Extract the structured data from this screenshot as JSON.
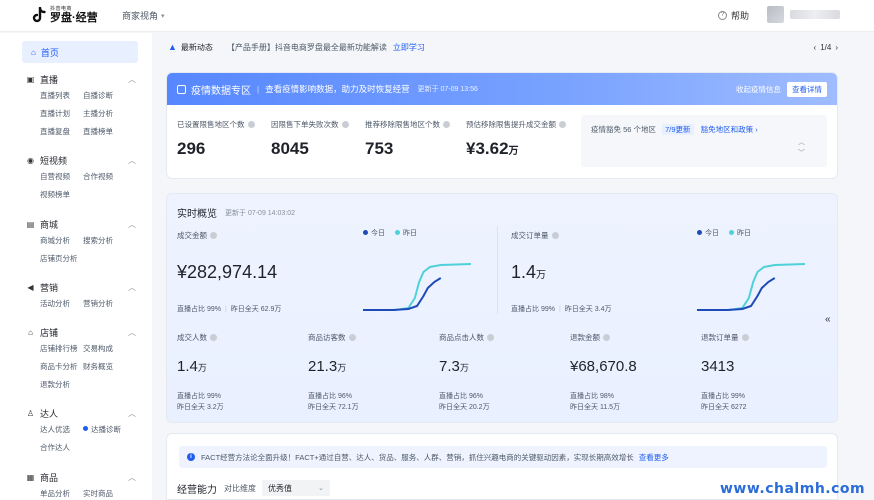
{
  "header": {
    "logo_sub": "抖音电商",
    "logo_main": "罗盘·经营",
    "role": "商家视角",
    "help": "帮助"
  },
  "sidebar": {
    "home": "首页",
    "groups": [
      {
        "title": "直播",
        "icon": "live-icon",
        "items": [
          "直播列表",
          "自播诊断",
          "直播计划",
          "主播分析",
          "直播复盘",
          "直播榜单"
        ]
      },
      {
        "title": "短视频",
        "icon": "video-icon",
        "items": [
          "自营视频",
          "合作视频",
          "视频榜单"
        ]
      },
      {
        "title": "商城",
        "icon": "mall-icon",
        "items": [
          "商城分析",
          "搜索分析",
          "店铺页分析"
        ]
      },
      {
        "title": "营销",
        "icon": "marketing-icon",
        "items": [
          "活动分析",
          "营销分析"
        ]
      },
      {
        "title": "店铺",
        "icon": "shop-icon",
        "items": [
          "店铺排行榜",
          "交易构成",
          "商品卡分析",
          "财务概览",
          "退款分析"
        ]
      },
      {
        "title": "达人",
        "icon": "talent-icon",
        "items": [
          "达人优选",
          "达播诊断",
          "合作达人"
        ]
      },
      {
        "title": "商品",
        "icon": "goods-icon",
        "items": [
          "单品分析",
          "实时商品"
        ]
      }
    ]
  },
  "news": {
    "title": "最新动态",
    "text": "【产品手册】抖音电商罗盘最全最新功能解读",
    "link": "立即学习",
    "page": "1/4"
  },
  "epidemic": {
    "title": "疫情数据专区",
    "subtitle": "查看疫情影响数据，助力及时恢复经营",
    "updated": "更新于 07-09 13:56",
    "collapse": "收起疫情信息",
    "detail_btn": "查看详情",
    "metrics": [
      {
        "label": "已设置限售地区个数",
        "value": "296",
        "unit": ""
      },
      {
        "label": "因限售下单失败次数",
        "value": "8045",
        "unit": ""
      },
      {
        "label": "推荐移除限售地区个数",
        "value": "753",
        "unit": ""
      },
      {
        "label": "预估移除限售提升成交金额",
        "value": "¥3.62",
        "unit": "万"
      }
    ],
    "panel": {
      "text": "疫情豁免 56 个地区",
      "badge": "7/9更新",
      "link": "豁免地区和政策 ›"
    }
  },
  "realtime": {
    "title": "实时概览",
    "updated": "更新于 07-09 14:03:02",
    "legend_today": "今日",
    "legend_yesterday": "昨日",
    "panels": [
      {
        "label": "成交金额",
        "value": "¥282,974.14",
        "unit": "",
        "ratio": "直播占比 99%",
        "yday": "昨日全天 62.9万"
      },
      {
        "label": "成交订单量",
        "value": "1.4",
        "unit": "万",
        "ratio": "直播占比 99%",
        "yday": "昨日全天 3.4万"
      }
    ],
    "metrics": [
      {
        "label": "成交人数",
        "value": "1.4",
        "unit": "万",
        "ratio": "直播占比 99%",
        "yday": "昨日全天 3.2万"
      },
      {
        "label": "商品访客数",
        "value": "21.3",
        "unit": "万",
        "ratio": "直播占比 96%",
        "yday": "昨日全天 72.1万"
      },
      {
        "label": "商品点击人数",
        "value": "7.3",
        "unit": "万",
        "ratio": "直播占比 96%",
        "yday": "昨日全天 20.2万"
      },
      {
        "label": "退款金额",
        "value": "¥68,670.8",
        "unit": "",
        "ratio": "直播占比 98%",
        "yday": "昨日全天 11.5万"
      },
      {
        "label": "退款订单量",
        "value": "3413",
        "unit": "",
        "ratio": "直播占比 99%",
        "yday": "昨日全天 6272"
      }
    ]
  },
  "fact": {
    "text": "FACT经营方法论全面升级！FACT+通过自营、达人、货品、服务、人群、营销，抓住兴趣电商的关键驱动因素，实现长期高效增长",
    "link": "查看更多"
  },
  "ability": {
    "title": "经营能力",
    "dimension": "对比维度",
    "select": "优秀值"
  },
  "watermark": "www.chalmh.com",
  "colors": {
    "accent": "#1f5cf2",
    "today": "#1f4bb8",
    "yesterday": "#4fd1d9"
  }
}
